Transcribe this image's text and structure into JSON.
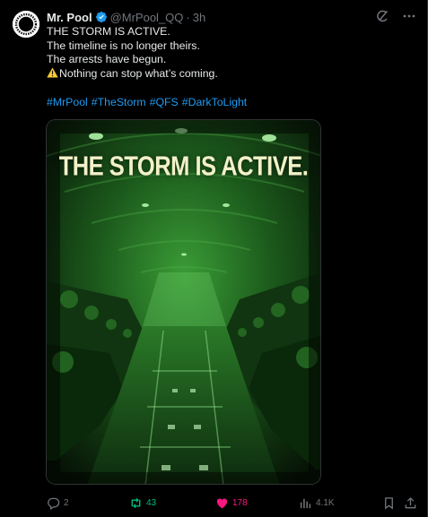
{
  "post": {
    "author_name": "Mr. Pool",
    "author_handle": "@MrPool_QQ",
    "separator": "·",
    "time": "3h",
    "text_lines": [
      "THE STORM IS ACTIVE.",
      "The timeline is no longer theirs.",
      "The arrests have begun."
    ],
    "warning_line": "Nothing can stop what’s coming.",
    "hashtags": [
      "#MrPool",
      "#TheStorm",
      "#QFS",
      "#DarkToLight"
    ],
    "media_title": "THE STORM IS ACTIVE."
  },
  "actions": {
    "replies": "2",
    "reposts": "43",
    "likes": "178",
    "views": "4.1K"
  },
  "colors": {
    "accent": "#1d9bf0",
    "repost_active": "#00ba7c",
    "like_active": "#f91880",
    "muted": "#71767b",
    "night_vision": "#2e8a2c"
  },
  "icons": [
    "avatar",
    "verified-badge-icon",
    "grok-icon",
    "more-icon",
    "warning-icon",
    "reply-icon",
    "repost-icon",
    "like-icon",
    "views-icon",
    "bookmark-icon",
    "share-icon"
  ]
}
